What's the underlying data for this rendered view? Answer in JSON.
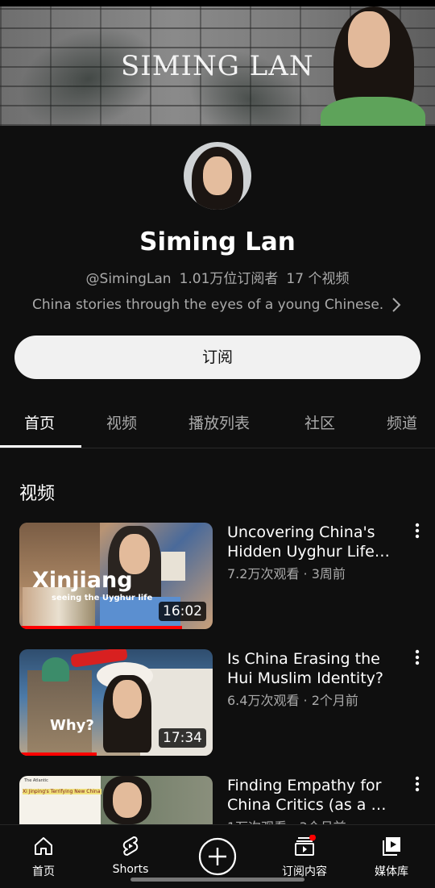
{
  "banner": {
    "title": "SIMING LAN"
  },
  "channel": {
    "name": "Siming Lan",
    "handle": "@SimingLan",
    "subscribers": "1.01万位订阅者",
    "video_count": "17 个视频",
    "description": "China stories through the eyes of a young Chinese."
  },
  "subscribe_label": "订阅",
  "tabs": [
    {
      "label": "首页",
      "active": true
    },
    {
      "label": "视频"
    },
    {
      "label": "播放列表"
    },
    {
      "label": "社区"
    },
    {
      "label": "频道"
    }
  ],
  "section_title": "视频",
  "videos": [
    {
      "title": "Uncovering China's Hidden Uyghur Life…",
      "views": "7.2万次观看",
      "age": "3周前",
      "duration": "16:02",
      "thumb_text": "Xinjiang",
      "thumb_subtext": "seeing the Uyghur life",
      "watched_fraction": 0.84
    },
    {
      "title": "Is China Erasing the Hui Muslim Identity?",
      "views": "6.4万次观看",
      "age": "2个月前",
      "duration": "17:34",
      "thumb_text": "Why?",
      "watched_fraction": 0.4
    },
    {
      "title": "Finding Empathy for China Critics (as a …",
      "views": "1万次观看",
      "age": "3个月前",
      "thumb_text": "Xi Jinping's Terrifying New China",
      "thumb_subtext": "The Atlantic"
    }
  ],
  "bottom_nav": [
    {
      "label": "首页",
      "icon": "home-icon"
    },
    {
      "label": "Shorts",
      "icon": "shorts-icon"
    },
    {
      "label": "",
      "icon": "create-plus-icon"
    },
    {
      "label": "订阅内容",
      "icon": "subscriptions-icon"
    },
    {
      "label": "媒体库",
      "icon": "library-icon"
    }
  ],
  "colors": {
    "background": "#0f0f0f",
    "accent": "#ff0000",
    "text_secondary": "#aaaaaa"
  }
}
